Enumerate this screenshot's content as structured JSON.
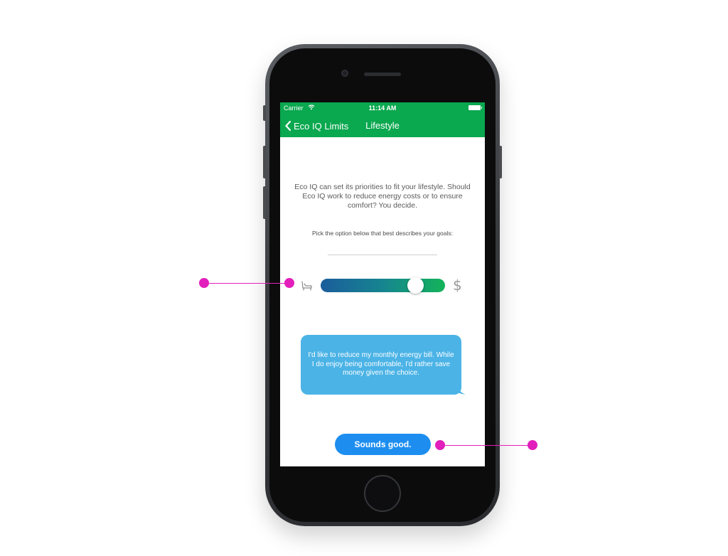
{
  "status_bar": {
    "carrier": "Carrier",
    "wifi_icon": "wifi-icon",
    "time": "11:14 AM",
    "battery_icon": "battery-icon"
  },
  "nav_bar": {
    "back_label": "Eco IQ Limits",
    "title": "Lifestyle",
    "color": "#0aa84f"
  },
  "content": {
    "intro_text": "Eco IQ can set its priorities to fit your lifestyle. Should Eco IQ work to reduce energy costs or to ensure comfort? You decide.",
    "pick_text": "Pick the option below that best describes your goals:",
    "slider": {
      "left_icon": "armchair-comfort-icon",
      "right_icon": "dollar-icon",
      "right_glyph": "$",
      "value": 0.76,
      "gradient_start": "#1b5c9c",
      "gradient_end": "#13b35a"
    },
    "bubble_text": "I'd like to reduce my monthly energy bill. While I do enjoy being comfortable, I'd rather save money given the choice.",
    "bubble_color": "#4bb3e6",
    "cta_label": "Sounds good.",
    "cta_color": "#1d8ef0"
  },
  "annotation_color": "#e21fbb"
}
